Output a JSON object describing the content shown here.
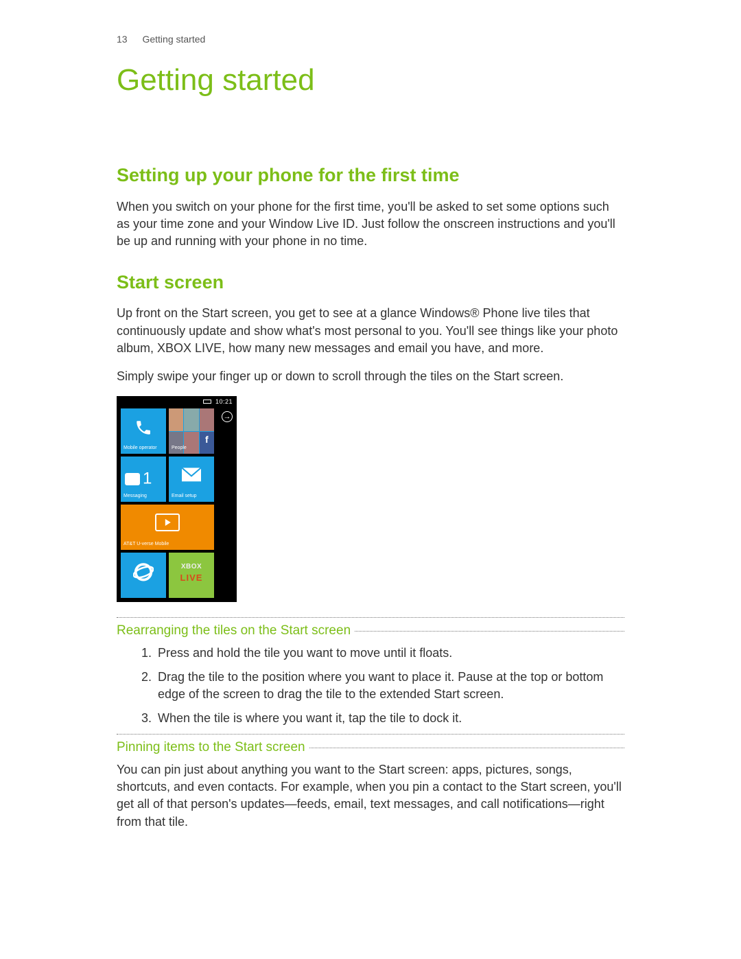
{
  "header": {
    "page_number": "13",
    "running_title": "Getting started"
  },
  "chapter_title": "Getting started",
  "section1": {
    "title": "Setting up your phone for the first time",
    "body": "When you switch on your phone for the first time, you'll be asked to set some options such as your time zone and your Window Live ID. Just follow the onscreen instructions and you'll be up and running with your phone in no time."
  },
  "section2": {
    "title": "Start screen",
    "body1": "Up front on the Start screen, you get to see at a glance Windows® Phone live tiles that continuously update and show what's most personal to you. You'll see things like your photo album, XBOX LIVE, how many new messages and email you have, and more.",
    "body2": "Simply swipe your finger up or down to scroll through the tiles on the Start screen."
  },
  "phone": {
    "clock": "10:21",
    "tiles": {
      "operator_label": "Mobile operator",
      "people_label": "People",
      "messaging_label": "Messaging",
      "messaging_count": "1",
      "email_label": "Email setup",
      "uverse_label": "AT&T U-verse Mobile",
      "xbox_top": "XBOX",
      "xbox_bottom": "LIVE"
    }
  },
  "sub1": {
    "title": "Rearranging the tiles on the Start screen",
    "steps": [
      "Press and hold the tile you want to move until it floats.",
      "Drag the tile to the position where you want to place it. Pause at the top or bottom edge of the screen to drag the tile to the extended Start screen.",
      "When the tile is where you want it, tap the tile to dock it."
    ]
  },
  "sub2": {
    "title": "Pinning items to the Start screen",
    "body": "You can pin just about anything you want to the Start screen: apps, pictures, songs, shortcuts, and even contacts. For example, when you pin a contact to the Start screen, you'll get all of that person's updates—feeds, email, text messages, and call notifications—right from that tile."
  }
}
